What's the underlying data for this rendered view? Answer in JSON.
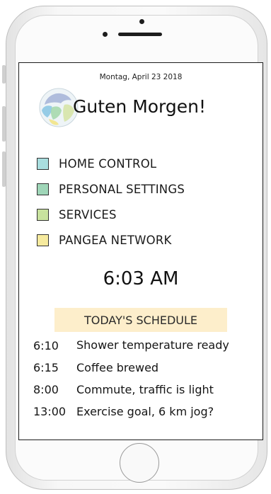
{
  "header": {
    "date": "Montag, April 23 2018",
    "greeting": "Guten Morgen!"
  },
  "menu": {
    "items": [
      {
        "label": "HOME CONTROL",
        "color": "#a9dedf"
      },
      {
        "label": "PERSONAL SETTINGS",
        "color": "#9fd6b8"
      },
      {
        "label": "SERVICES",
        "color": "#c8e29e"
      },
      {
        "label": "PANGEA NETWORK",
        "color": "#f6ea9e"
      }
    ]
  },
  "clock": {
    "time": "6:03 AM"
  },
  "schedule": {
    "title": "TODAY'S SCHEDULE",
    "items": [
      {
        "time": "6:10",
        "text": "Shower temperature ready"
      },
      {
        "time": "6:15",
        "text": "Coffee brewed"
      },
      {
        "time": "8:00",
        "text": "Commute, traffic is light"
      },
      {
        "time": "13:00",
        "text": "Exercise goal, 6 km jog?"
      }
    ]
  }
}
